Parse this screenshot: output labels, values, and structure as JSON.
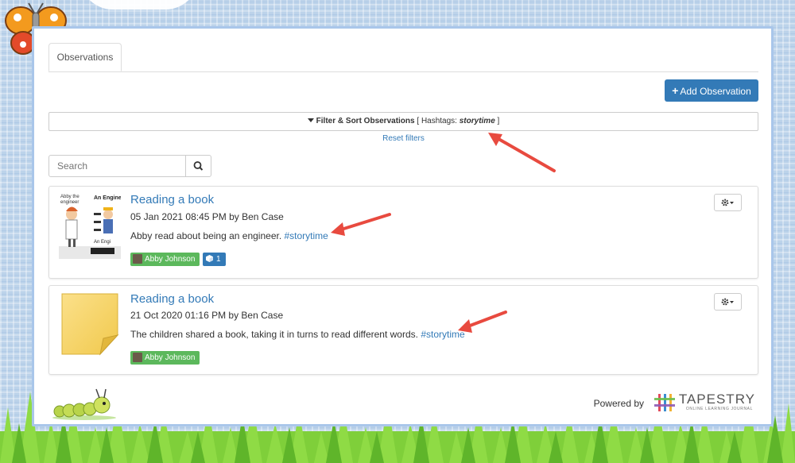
{
  "tabs": [
    {
      "label": "Observations"
    }
  ],
  "toolbar": {
    "add_label": "Add Observation"
  },
  "filter": {
    "label": "Filter & Sort Observations",
    "open_bracket": "[",
    "hashtags_prefix": "Hashtags:",
    "hashtag_value": "storytime",
    "close_bracket": "]",
    "reset_label": "Reset filters"
  },
  "search": {
    "placeholder": "Search"
  },
  "observations": [
    {
      "title": "Reading a book",
      "meta": "05 Jan 2021 08:45 PM by Ben Case",
      "text": "Abby read about being an engineer.",
      "hashtag": "#storytime",
      "child": "Abby Johnson",
      "media_count": "1"
    },
    {
      "title": "Reading a book",
      "meta": "21 Oct 2020 01:16 PM by Ben Case",
      "text": "The children shared a book, taking it in turns to read different words.",
      "hashtag": "#storytime",
      "child": "Abby Johnson"
    }
  ],
  "footer": {
    "powered_by": "Powered by",
    "brand": "TAPESTRY",
    "brand_sub": "ONLINE LEARNING JOURNAL"
  },
  "colors": {
    "primary": "#337ab7",
    "success": "#5cb85c",
    "annotation": "#e84a3f"
  }
}
